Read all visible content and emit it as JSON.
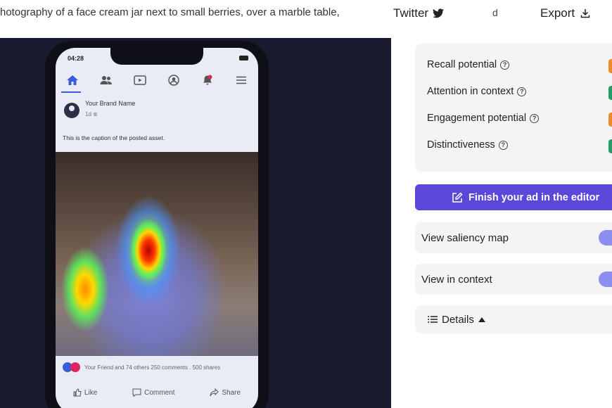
{
  "prompt_text": "hotography of a face cream jar next to small berries, over a marble table,",
  "header": {
    "twitter_label": "Twitter",
    "partial_char": "d",
    "export_label": "Export"
  },
  "phone": {
    "time": "04:28",
    "brand_name": "Your Brand Name",
    "brand_meta": "1d",
    "caption": "This is the caption of the posted asset.",
    "reactions_text": "Your Friend and 74 others   250 comments . 500 shares",
    "actions": {
      "like": "Like",
      "comment": "Comment",
      "share": "Share"
    }
  },
  "metrics": [
    {
      "label": "Recall potential",
      "color": "#f08a24"
    },
    {
      "label": "Attention in context",
      "color": "#1f9e6a"
    },
    {
      "label": "Engagement potential",
      "color": "#f08a24"
    },
    {
      "label": "Distinctiveness",
      "color": "#1f9e6a"
    }
  ],
  "finish_button": "Finish your ad in the editor",
  "toggles": {
    "saliency": {
      "label": "View saliency map",
      "on": true
    },
    "context": {
      "label": "View in context",
      "on": true
    }
  },
  "details_label": "Details",
  "colors": {
    "accent": "#5b48d8",
    "toggle": "#8b8ef0"
  }
}
